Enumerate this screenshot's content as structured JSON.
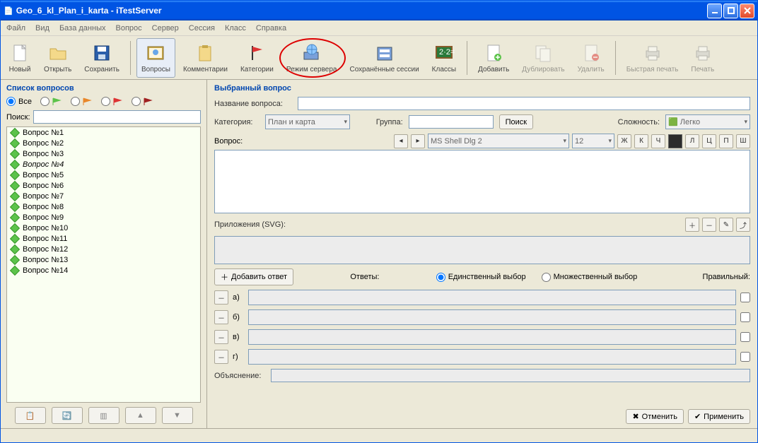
{
  "titlebar": {
    "title": "Geo_6_kl_Plan_i_karta - iTestServer"
  },
  "menu": {
    "file": "Файл",
    "view": "Вид",
    "db": "База данных",
    "question": "Вопрос",
    "server": "Сервер",
    "session": "Сессия",
    "class": "Класс",
    "help": "Справка"
  },
  "toolbar": {
    "new": "Новый",
    "open": "Открыть",
    "save": "Сохранить",
    "questions": "Вопросы",
    "comments": "Комментарии",
    "categories": "Категории",
    "server_mode": "Режим сервера",
    "saved_sessions": "Сохранённые сессии",
    "classes": "Классы",
    "add": "Добавить",
    "duplicate": "Дублировать",
    "delete": "Удалить",
    "quick_print": "Быстрая печать",
    "print": "Печать"
  },
  "left": {
    "title": "Список вопросов",
    "all_label": "Все",
    "search_label": "Поиск:",
    "items": [
      {
        "label": "Вопрос №1"
      },
      {
        "label": "Вопрос №2"
      },
      {
        "label": "Вопрос №3"
      },
      {
        "label": "Вопрос №4",
        "active": true
      },
      {
        "label": "Вопрос №5"
      },
      {
        "label": "Вопрос №6"
      },
      {
        "label": "Вопрос №7"
      },
      {
        "label": "Вопрос №8"
      },
      {
        "label": "Вопрос №9"
      },
      {
        "label": "Вопрос №10"
      },
      {
        "label": "Вопрос №11"
      },
      {
        "label": "Вопрос №12"
      },
      {
        "label": "Вопрос №13"
      },
      {
        "label": "Вопрос №14"
      }
    ]
  },
  "right": {
    "title": "Выбранный вопрос",
    "name_label": "Название вопроса:",
    "category_label": "Категория:",
    "category_value": "План и карта",
    "group_label": "Группа:",
    "search_btn": "Поиск",
    "difficulty_label": "Сложность:",
    "difficulty_value": "Легко",
    "question_label": "Вопрос:",
    "font_value": "MS Shell Dlg 2",
    "size_value": "12",
    "btn_bold": "Ж",
    "btn_italic": "К",
    "btn_under": "Ч",
    "btn_left": "Л",
    "btn_center": "Ц",
    "btn_right": "П",
    "btn_strike": "Ш",
    "attachments": "Приложения (SVG):",
    "add_answer": "Добавить ответ",
    "answers_label": "Ответы:",
    "single_choice": "Единственный выбор",
    "multi_choice": "Множественный выбор",
    "correct_label": "Правильный:",
    "answers": [
      {
        "letter": "а)"
      },
      {
        "letter": "б)"
      },
      {
        "letter": "в)"
      },
      {
        "letter": "г)"
      }
    ],
    "explain": "Объяснение:",
    "cancel": "Отменить",
    "apply": "Применить"
  }
}
